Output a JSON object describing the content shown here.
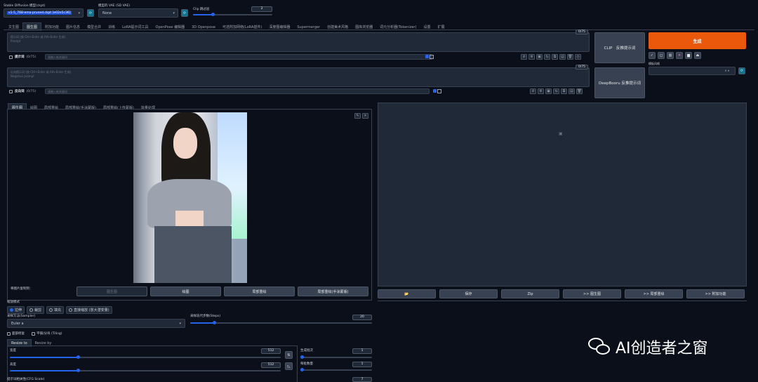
{
  "top": {
    "sd_model_label": "Stable Diffusion 模型(ckpt)",
    "sd_model_value": "v1-5_768-ema-pruned.ckpt [e02e5c36]",
    "vae_label": "模型的 VAE (SD VAE)",
    "vae_value": "None",
    "clip_label": "Clip 跳过层",
    "clip_value": "2",
    "clip_fraction": 0.25
  },
  "main_tabs": [
    "文生图",
    "图生图",
    "附加功能",
    "图片信息",
    "模型合并",
    "训练",
    "LoRA提示词工具",
    "OpenPose 编辑器",
    "3D Openpose",
    "可选附加网络(LoRA插件)",
    "深度图编辑器",
    "Supermerger",
    "创建美术风格",
    "图库浏览器",
    "词元分析器(Tokenizer)",
    "设置",
    "扩展"
  ],
  "prompt": {
    "counter": "0/75",
    "placeholder": "提示词 (按 Ctrl+Enter 或 Alt+Enter 生成)\nPrompt",
    "label": "提示词",
    "label_count": "(0/75)",
    "input_placeholder": "请输入新关键词"
  },
  "neg": {
    "counter": "0/75",
    "placeholder": "反向提示词 (按 Ctrl+Enter 或 Alt+Enter 生成)\nNegative prompt",
    "label": "反向词",
    "label_count": "(0/75)",
    "input_placeholder": "请输入新关键词"
  },
  "side": {
    "clip_btn": "CLIP　反推提示词",
    "deepbooru_btn": "DeepBooru 反推提示词",
    "generate": "生成",
    "style_label": "模板风格",
    "generate_color": "#ea580c"
  },
  "sub_tabs": [
    "图生图",
    "绘图",
    "局部重绘",
    "局部重绘(手涂蒙版)",
    "局部重绘(上传蒙版)",
    "批量处理"
  ],
  "copy": {
    "label": "将图片复制到：",
    "buttons": [
      "图生图",
      "绘图",
      "局部重绘",
      "局部重绘(手涂蒙版)"
    ]
  },
  "output_buttons": [
    "📂",
    "保存",
    "Zip",
    ">> 图生图",
    ">> 局部重绘",
    ">> 附加功能"
  ],
  "resize": {
    "label": "缩放模式",
    "options": [
      "拉伸",
      "裁剪",
      "填充",
      "直接缩放 (放大潜变量)"
    ],
    "selected": 0
  },
  "sampler": {
    "label": "采样方法(Sampler)",
    "value": "Euler a"
  },
  "steps": {
    "label": "采样迭代步数(Steps)",
    "value": "20",
    "fraction": 0.13
  },
  "checks": [
    "面部修复",
    "平铺/分块 (Tiling)"
  ],
  "resize_tabs": [
    "Resize to",
    "Resize by"
  ],
  "width": {
    "label": "宽度",
    "value": "512",
    "fraction": 0.25
  },
  "height": {
    "label": "高度",
    "value": "512",
    "fraction": 0.25
  },
  "batch_count": {
    "label": "生成批次",
    "value": "1",
    "fraction": 0.0
  },
  "batch_size": {
    "label": "每批数量",
    "value": "1",
    "fraction": 0.0
  },
  "cfg": {
    "label": "提示词相关性(CFG Scale)",
    "value": "7"
  },
  "watermark": "AI创造者之窗"
}
